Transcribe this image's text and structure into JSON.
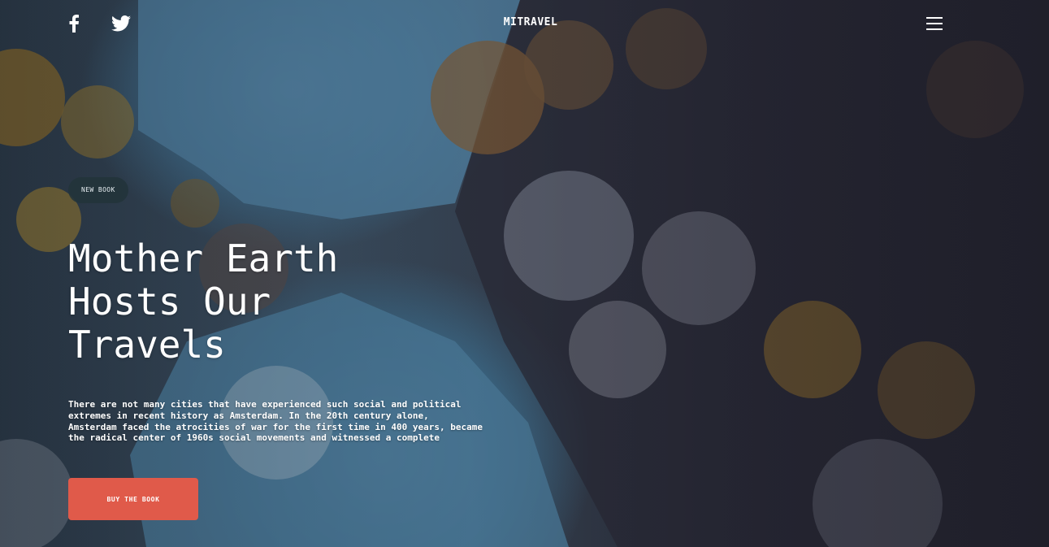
{
  "header": {
    "brand": "MITRAVEL",
    "social": [
      {
        "icon": "facebook-icon"
      },
      {
        "icon": "twitter-icon"
      }
    ],
    "menu_icon": "hamburger-menu-icon"
  },
  "hero": {
    "badge": "NEW BOOK",
    "title_lines": [
      "Mother Earth",
      "Hosts Our",
      "Travels"
    ],
    "paragraph_lines": [
      "There are not many cities that have experienced such social and political",
      "extremes in recent history as Amsterdam. In the 20th century alone,",
      "Amsterdam faced the atrocities of war for the first time in 400 years, became",
      "the radical center of 1960s social movements and witnessed a complete"
    ],
    "cta_label": "BUY THE BOOK"
  },
  "colors": {
    "accent": "#e05a4a",
    "badge_bg": "#22343a",
    "text": "#ffffff"
  }
}
